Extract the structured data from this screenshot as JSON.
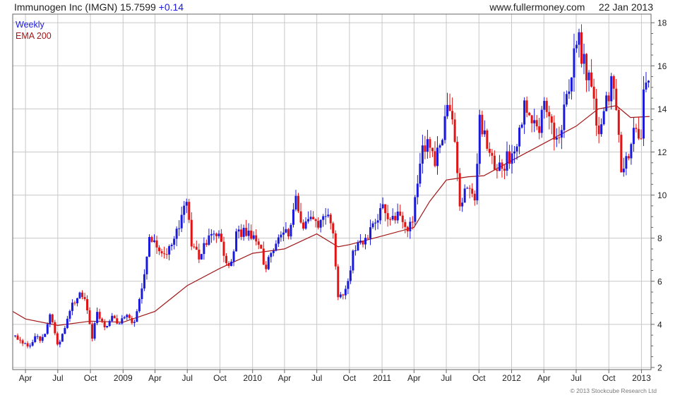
{
  "header": {
    "security": "Immunogen Inc (IMGN)",
    "price": "15.7599",
    "change": "+0.14",
    "site": "www.fullermoney.com",
    "date": "22 Jan 2013"
  },
  "copyright": "© 2013 Stockcube Research Ltd",
  "colors": {
    "up": "#1a1adc",
    "down": "#e01414",
    "ema": "#a11616",
    "grid": "#c8c8c8",
    "axis": "#666666"
  },
  "chart_data": {
    "type": "candlestick",
    "frequency": "weekly",
    "legend": [
      "Weekly",
      "EMA 200"
    ],
    "legend_position": "top-left",
    "grid": true,
    "y_axis_side": "right",
    "ylim": [
      1.9,
      18.4
    ],
    "yticks": [
      2,
      4,
      6,
      8,
      10,
      12,
      14,
      16,
      18
    ],
    "xlim": [
      "2008-02-25",
      "2013-01-28"
    ],
    "xticks": [
      {
        "date": "2008-04-01",
        "label": "Apr"
      },
      {
        "date": "2008-07-01",
        "label": "Jul"
      },
      {
        "date": "2008-10-01",
        "label": "Oct"
      },
      {
        "date": "2009-01-01",
        "label": "2009"
      },
      {
        "date": "2009-04-01",
        "label": "Apr"
      },
      {
        "date": "2009-07-01",
        "label": "Jul"
      },
      {
        "date": "2009-10-01",
        "label": "Oct"
      },
      {
        "date": "2010-01-01",
        "label": "2010"
      },
      {
        "date": "2010-04-01",
        "label": "Apr"
      },
      {
        "date": "2010-07-01",
        "label": "Jul"
      },
      {
        "date": "2010-10-01",
        "label": "Oct"
      },
      {
        "date": "2011-01-01",
        "label": "2011"
      },
      {
        "date": "2011-04-01",
        "label": "Apr"
      },
      {
        "date": "2011-07-01",
        "label": "Jul"
      },
      {
        "date": "2011-10-01",
        "label": "Oct"
      },
      {
        "date": "2012-01-01",
        "label": "2012"
      },
      {
        "date": "2012-04-01",
        "label": "Apr"
      },
      {
        "date": "2012-07-01",
        "label": "Jul"
      },
      {
        "date": "2012-10-01",
        "label": "Oct"
      },
      {
        "date": "2013-01-01",
        "label": "2013"
      }
    ],
    "close_path": [
      [
        "2008-03-03",
        3.45
      ],
      [
        "2008-03-24",
        3.15
      ],
      [
        "2008-04-07",
        2.9
      ],
      [
        "2008-04-28",
        3.4
      ],
      [
        "2008-05-19",
        3.3
      ],
      [
        "2008-06-09",
        4.45
      ],
      [
        "2008-06-30",
        3.0
      ],
      [
        "2008-07-14",
        3.5
      ],
      [
        "2008-08-04",
        4.6
      ],
      [
        "2008-08-25",
        5.4
      ],
      [
        "2008-09-08",
        5.2
      ],
      [
        "2008-09-22",
        4.8
      ],
      [
        "2008-10-06",
        3.4
      ],
      [
        "2008-10-20",
        4.6
      ],
      [
        "2008-11-10",
        3.9
      ],
      [
        "2008-12-01",
        4.3
      ],
      [
        "2008-12-22",
        4.1
      ],
      [
        "2009-01-12",
        4.6
      ],
      [
        "2009-02-02",
        4.0
      ],
      [
        "2009-02-23",
        5.8
      ],
      [
        "2009-03-16",
        7.9
      ],
      [
        "2009-04-06",
        7.7
      ],
      [
        "2009-04-27",
        7.1
      ],
      [
        "2009-05-18",
        7.8
      ],
      [
        "2009-06-08",
        8.5
      ],
      [
        "2009-06-29",
        9.8
      ],
      [
        "2009-07-13",
        7.6
      ],
      [
        "2009-08-03",
        7.2
      ],
      [
        "2009-08-24",
        7.7
      ],
      [
        "2009-09-14",
        8.4
      ],
      [
        "2009-10-05",
        7.7
      ],
      [
        "2009-10-26",
        6.5
      ],
      [
        "2009-11-16",
        8.1
      ],
      [
        "2009-12-07",
        8.4
      ],
      [
        "2009-12-28",
        8.1
      ],
      [
        "2010-01-18",
        7.6
      ],
      [
        "2010-02-08",
        6.6
      ],
      [
        "2010-03-01",
        7.6
      ],
      [
        "2010-03-22",
        8.2
      ],
      [
        "2010-04-12",
        8.3
      ],
      [
        "2010-05-03",
        9.8
      ],
      [
        "2010-05-24",
        8.6
      ],
      [
        "2010-06-14",
        9.1
      ],
      [
        "2010-07-05",
        8.3
      ],
      [
        "2010-07-26",
        9.2
      ],
      [
        "2010-08-16",
        8.2
      ],
      [
        "2010-08-30",
        5.1
      ],
      [
        "2010-09-20",
        5.5
      ],
      [
        "2010-10-11",
        7.2
      ],
      [
        "2010-11-01",
        8.0
      ],
      [
        "2010-11-22",
        7.9
      ],
      [
        "2010-12-13",
        8.9
      ],
      [
        "2011-01-03",
        9.4
      ],
      [
        "2011-01-24",
        8.6
      ],
      [
        "2011-02-14",
        9.0
      ],
      [
        "2011-03-07",
        8.3
      ],
      [
        "2011-03-28",
        8.8
      ],
      [
        "2011-04-18",
        11.8
      ],
      [
        "2011-05-09",
        12.5
      ],
      [
        "2011-05-30",
        11.5
      ],
      [
        "2011-06-20",
        12.7
      ],
      [
        "2011-07-04",
        14.2
      ],
      [
        "2011-07-25",
        12.9
      ],
      [
        "2011-08-08",
        9.6
      ],
      [
        "2011-08-29",
        10.3
      ],
      [
        "2011-09-19",
        10.0
      ],
      [
        "2011-10-03",
        13.3
      ],
      [
        "2011-10-24",
        12.5
      ],
      [
        "2011-11-14",
        11.0
      ],
      [
        "2011-12-05",
        11.4
      ],
      [
        "2011-12-26",
        11.8
      ],
      [
        "2012-01-16",
        12.3
      ],
      [
        "2012-02-06",
        14.3
      ],
      [
        "2012-02-27",
        13.6
      ],
      [
        "2012-03-19",
        13.3
      ],
      [
        "2012-04-09",
        14.2
      ],
      [
        "2012-04-30",
        12.5
      ],
      [
        "2012-05-21",
        13.3
      ],
      [
        "2012-06-11",
        14.8
      ],
      [
        "2012-07-02",
        17.4
      ],
      [
        "2012-07-23",
        16.2
      ],
      [
        "2012-08-13",
        14.7
      ],
      [
        "2012-09-03",
        13.0
      ],
      [
        "2012-09-24",
        14.2
      ],
      [
        "2012-10-08",
        15.1
      ],
      [
        "2012-10-22",
        14.4
      ],
      [
        "2012-11-05",
        11.2
      ],
      [
        "2012-11-19",
        11.5
      ],
      [
        "2012-12-10",
        12.8
      ],
      [
        "2012-12-31",
        12.3
      ],
      [
        "2013-01-07",
        14.6
      ],
      [
        "2013-01-21",
        15.76
      ]
    ],
    "ema_path": [
      [
        "2008-02-25",
        4.6
      ],
      [
        "2008-04-01",
        4.25
      ],
      [
        "2008-07-01",
        3.95
      ],
      [
        "2008-10-01",
        4.15
      ],
      [
        "2009-01-01",
        4.1
      ],
      [
        "2009-04-01",
        4.6
      ],
      [
        "2009-07-01",
        5.8
      ],
      [
        "2009-10-01",
        6.6
      ],
      [
        "2010-01-01",
        7.3
      ],
      [
        "2010-04-01",
        7.5
      ],
      [
        "2010-07-01",
        8.2
      ],
      [
        "2010-08-30",
        7.6
      ],
      [
        "2010-10-01",
        7.7
      ],
      [
        "2011-01-01",
        8.1
      ],
      [
        "2011-04-01",
        8.5
      ],
      [
        "2011-05-15",
        9.7
      ],
      [
        "2011-07-01",
        10.7
      ],
      [
        "2011-09-01",
        10.85
      ],
      [
        "2011-10-15",
        10.9
      ],
      [
        "2012-01-01",
        11.6
      ],
      [
        "2012-04-01",
        12.4
      ],
      [
        "2012-07-01",
        13.2
      ],
      [
        "2012-09-01",
        14.0
      ],
      [
        "2012-10-22",
        14.15
      ],
      [
        "2012-12-01",
        13.6
      ],
      [
        "2013-01-24",
        13.65
      ]
    ]
  }
}
